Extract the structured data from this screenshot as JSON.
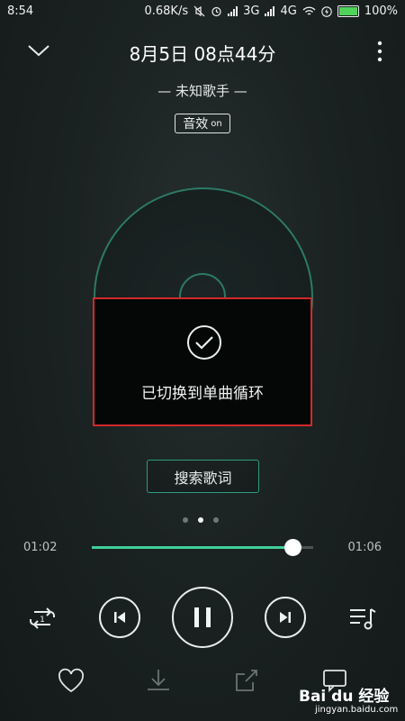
{
  "status_bar": {
    "time": "8:54",
    "net_speed": "0.68K/s",
    "network_3g": "3G",
    "network_4g": "4G",
    "battery": "100%"
  },
  "header": {
    "title": "8月5日 08点44分",
    "artist": "— 未知歌手 —",
    "effect_label": "音效",
    "effect_state": "on"
  },
  "toast": {
    "message": "已切换到单曲循环"
  },
  "lyrics_button": {
    "label": "搜索歌词"
  },
  "pager": {
    "pages": 3,
    "active": 2
  },
  "progress": {
    "current": "01:02",
    "total": "01:06",
    "fraction": 0.91
  },
  "colors": {
    "accent": "#3fcf9c",
    "highlight_border": "#d3282b"
  },
  "watermark": {
    "brand": "Bai du 经验",
    "url": "jingyan.baidu.com"
  }
}
